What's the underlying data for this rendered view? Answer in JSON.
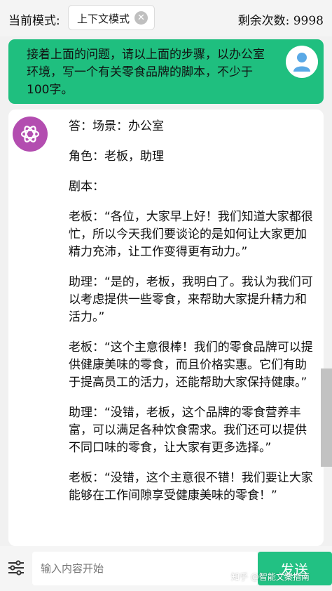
{
  "header": {
    "mode_label": "当前模式:",
    "mode_value": "上下文模式",
    "mode_clear_icon": "close-icon",
    "remaining": "剩余次数: 9998"
  },
  "user_message": {
    "text": "接着上面的问题，请以上面的步骤，以办公室环境，写一个有关零食品牌的脚本，不少于100字。",
    "avatar_icon": "user-icon"
  },
  "ai_message": {
    "avatar_icon": "openai-logo-icon",
    "paragraphs": [
      "答：场景：办公室",
      "角色：老板，助理",
      "剧本：",
      "老板：“各位，大家早上好！我们知道大家都很忙，所以今天我们要谈论的是如何让大家更加精力充沛，让工作变得更有动力。”",
      "助理：“是的，老板，我明白了。我认为我们可以考虑提供一些零食，来帮助大家提升精力和活力。”",
      "老板：“这个主意很棒！我们的零食品牌可以提供健康美味的零食，而且价格实惠。它们有助于提高员工的活力，还能帮助大家保持健康。”",
      "助理：“没错，老板，这个品牌的零食营养丰富，可以满足各种饮食需求。我们还可以提供不同口味的零食，让大家有更多选择。”",
      "老板：“没错，这个主意很不错！我们要让大家能够在工作间隙享受健康美味的零食！”"
    ]
  },
  "input_bar": {
    "settings_icon": "sliders-icon",
    "placeholder": "输入内容开始",
    "send_label": "发送"
  },
  "watermark": "知乎 @智能文案指南",
  "colors": {
    "accent_green": "#1fbf7f",
    "send_green": "#22c183",
    "avatar_purple": "#b34db0",
    "user_avatar_blue": "#5aa9e6"
  }
}
